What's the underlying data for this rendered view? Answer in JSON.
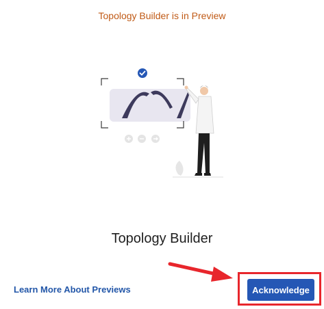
{
  "dialog": {
    "notice": "Topology Builder is in Preview",
    "title": "Topology Builder",
    "learn_more_label": "Learn More About Previews",
    "acknowledge_label": "Acknowledge"
  },
  "colors": {
    "notice": "#c05a16",
    "link": "#2256a8",
    "button": "#2557b5",
    "highlight": "#e8262c"
  },
  "icons": [
    "checkmark-icon",
    "plus-icon",
    "minus-icon",
    "arrow-right-icon"
  ]
}
